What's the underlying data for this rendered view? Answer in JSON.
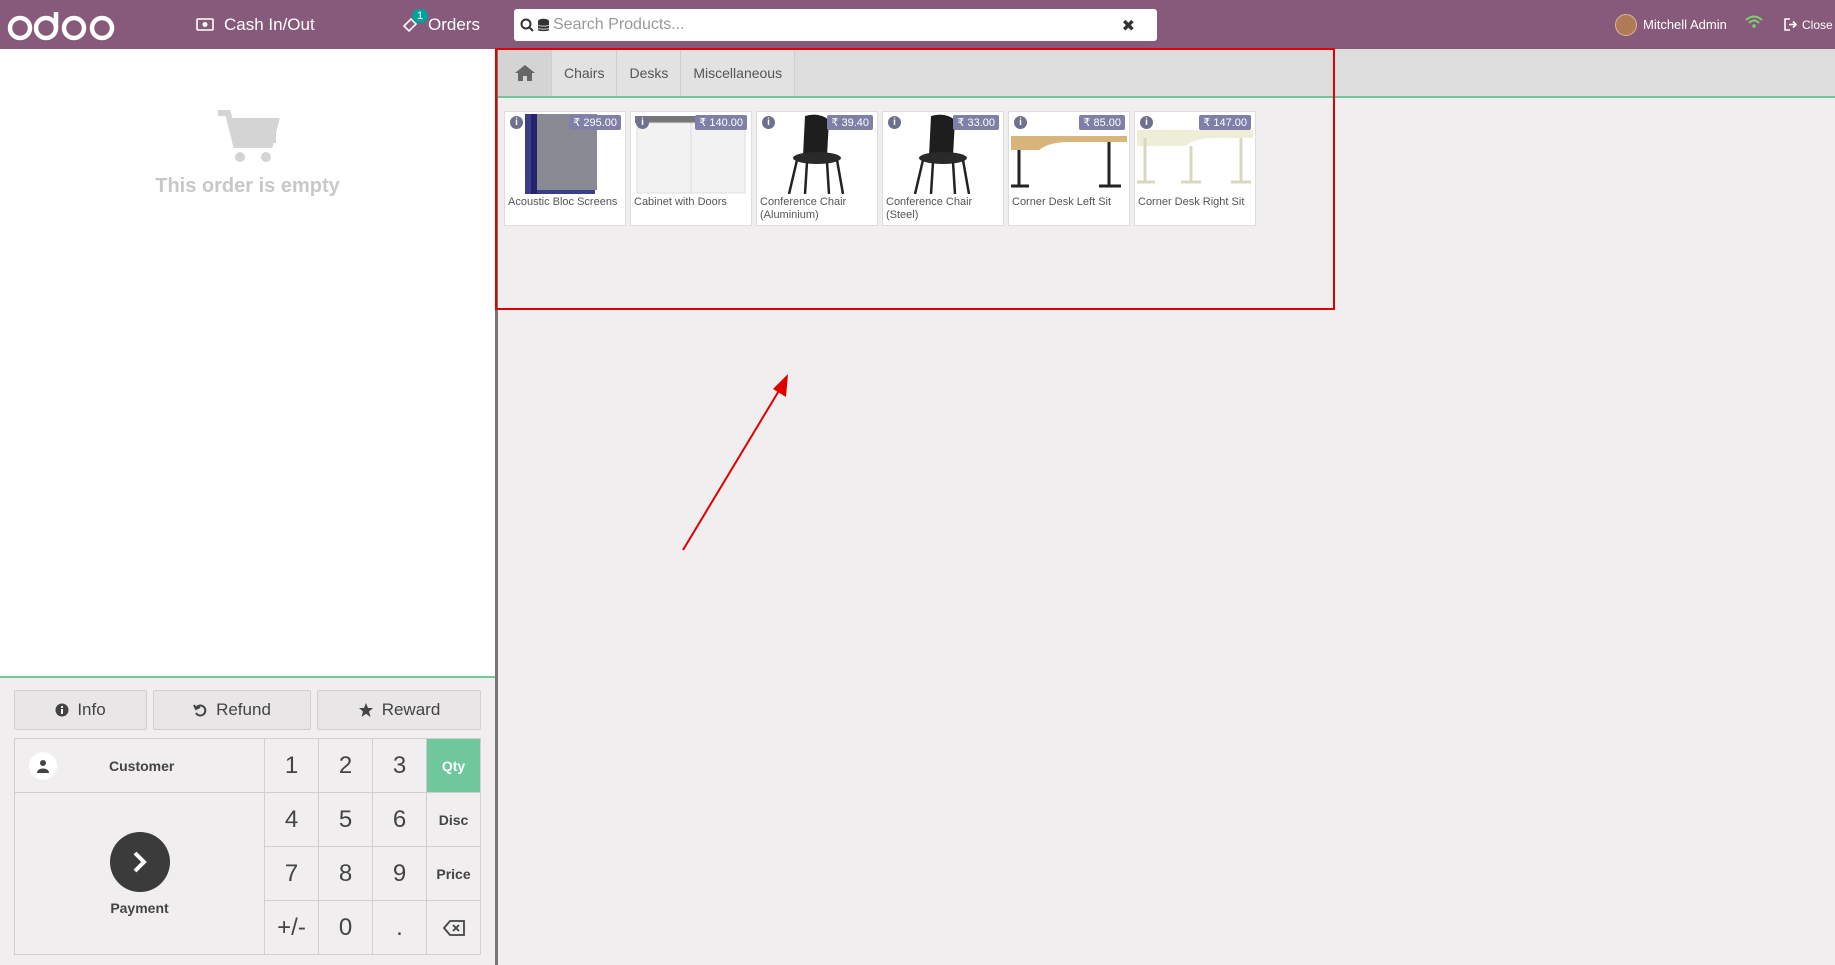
{
  "header": {
    "logo_text": "odoo",
    "cash_label": "Cash In/Out",
    "orders_label": "Orders",
    "orders_badge": "1",
    "search_placeholder": "Search Products...",
    "user_name": "Mitchell Admin",
    "close_label": "Close"
  },
  "order": {
    "empty_text": "This order is empty"
  },
  "controls": {
    "info_label": "Info",
    "refund_label": "Refund",
    "reward_label": "Reward",
    "customer_label": "Customer",
    "payment_label": "Payment"
  },
  "numpad": [
    "1",
    "2",
    "3",
    "Qty",
    "4",
    "5",
    "6",
    "Disc",
    "7",
    "8",
    "9",
    "Price",
    "+/-",
    "0",
    "."
  ],
  "categories": [
    "Chairs",
    "Desks",
    "Miscellaneous"
  ],
  "products": [
    {
      "name": "Acoustic Bloc Screens",
      "price": "₹ 295.00"
    },
    {
      "name": "Cabinet with Doors",
      "price": "₹ 140.00"
    },
    {
      "name": "Conference Chair (Aluminium)",
      "price": "₹ 39.40"
    },
    {
      "name": "Conference Chair (Steel)",
      "price": "₹ 33.00"
    },
    {
      "name": "Corner Desk Left Sit",
      "price": "₹ 85.00"
    },
    {
      "name": "Corner Desk Right Sit",
      "price": "₹ 147.00"
    }
  ],
  "colors": {
    "header": "#875a7b",
    "accent": "#6ec89b",
    "annotation": "#e00000"
  }
}
